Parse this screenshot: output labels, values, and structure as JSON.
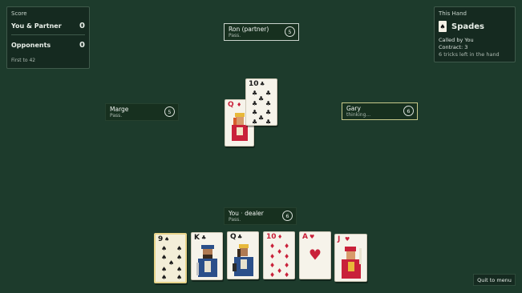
{
  "score": {
    "title": "Score",
    "team1_label": "You & Partner",
    "team1_value": "0",
    "team2_label": "Opponents",
    "team2_value": "0",
    "footer": "First to 42"
  },
  "this_hand": {
    "title": "This Hand",
    "trump_suit": "Spades",
    "trump_icon": "♠",
    "called_by": "Called by You",
    "contract": "Contract: 3",
    "tricks_left": "6 tricks left in the hand"
  },
  "players": {
    "north": {
      "name": "Ron (partner)",
      "status": "Pass.",
      "cards": "5"
    },
    "west": {
      "name": "Marge",
      "status": "Pass.",
      "cards": "5"
    },
    "east": {
      "name": "Gary",
      "status": "thinking...",
      "cards": "6"
    },
    "south": {
      "name": "You",
      "role": "dealer",
      "separator": "·",
      "status": "Pass.",
      "cards": "6"
    }
  },
  "table_cards": [
    {
      "rank": "Q",
      "suit": "♦",
      "color": "red",
      "face": "queen"
    },
    {
      "rank": "10",
      "suit": "♣",
      "color": "black",
      "face": "pips"
    }
  ],
  "hand_cards": [
    {
      "rank": "9",
      "suit": "♠",
      "color": "black",
      "selected": true
    },
    {
      "rank": "K",
      "suit": "♣",
      "color": "black"
    },
    {
      "rank": "Q",
      "suit": "♣",
      "color": "black"
    },
    {
      "rank": "10",
      "suit": "♦",
      "color": "red"
    },
    {
      "rank": "A",
      "suit": "♥",
      "color": "red"
    },
    {
      "rank": "J",
      "suit": "♥",
      "color": "red"
    }
  ],
  "buttons": {
    "quit": "Quit to menu"
  }
}
